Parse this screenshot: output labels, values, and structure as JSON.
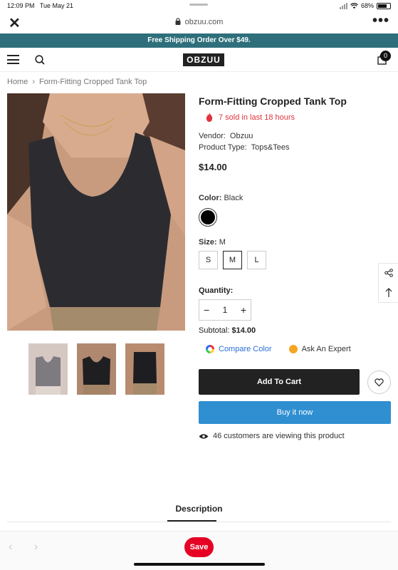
{
  "status_bar": {
    "time": "12:09 PM",
    "date": "Tue May 21",
    "battery": "68%"
  },
  "browser": {
    "url": "obzuu.com"
  },
  "promo": {
    "text": "Free Shipping Order Over $49."
  },
  "header": {
    "logo": "OBZUU",
    "cart_count": "0"
  },
  "breadcrumb": {
    "home": "Home",
    "separator": "›",
    "current": "Form-Fitting Cropped Tank Top"
  },
  "product": {
    "title": "Form-Fitting Cropped Tank Top",
    "sold_text": "7 sold in last 18 hours",
    "vendor_label": "Vendor:",
    "vendor": "Obzuu",
    "type_label": "Product Type:",
    "type": "Tops&Tees",
    "price": "$14.00",
    "color_label": "Color:",
    "color_value": "Black",
    "size_label": "Size:",
    "size_value": "M",
    "sizes": [
      "S",
      "M",
      "L"
    ],
    "quantity_label": "Quantity:",
    "quantity": "1",
    "subtotal_label": "Subtotal:",
    "subtotal": "$14.00",
    "compare_color": "Compare Color",
    "ask_expert": "Ask An Expert",
    "add_to_cart": "Add To Cart",
    "buy_now": "Buy it now",
    "viewing": "46 customers are viewing this product"
  },
  "tabs": {
    "description": "Description"
  },
  "bottom": {
    "save": "Save"
  },
  "colors": {
    "promo_bg": "#2f6f7b",
    "buy_now": "#2f8fd1",
    "sold_red": "#e0343c",
    "pinterest": "#e60023"
  }
}
